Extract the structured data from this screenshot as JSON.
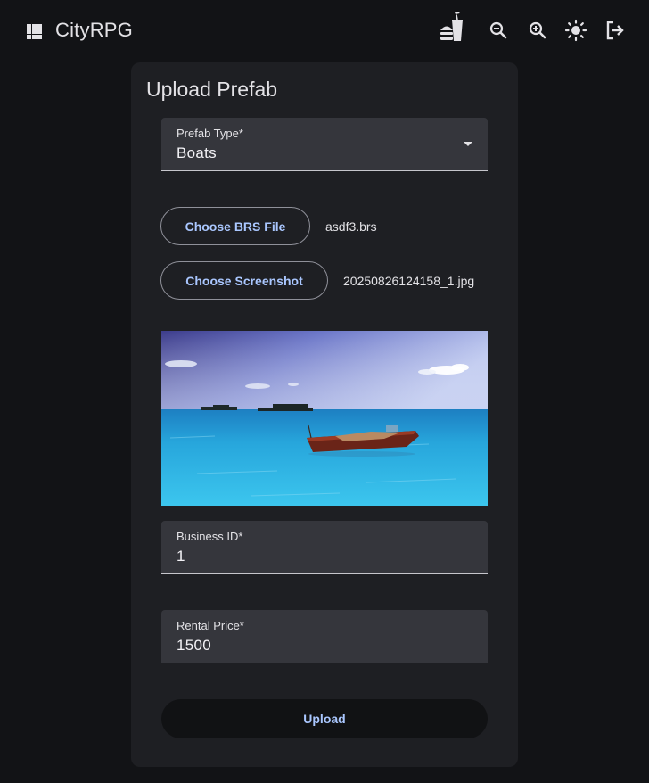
{
  "app": {
    "title": "CityRPG"
  },
  "toolbar": {
    "icons": [
      "burger-soda-icon",
      "zoom-out-icon",
      "zoom-in-icon",
      "light-mode-icon",
      "logout-icon"
    ]
  },
  "form": {
    "title": "Upload Prefab",
    "prefab_type": {
      "label": "Prefab Type*",
      "value": "Boats"
    },
    "brs_file": {
      "button_label": "Choose BRS File",
      "file_name": "asdf3.brs"
    },
    "screenshot": {
      "button_label": "Choose Screenshot",
      "file_name": "20250826124158_1.jpg"
    },
    "business_id": {
      "label": "Business ID*",
      "value": "1"
    },
    "rental_price": {
      "label": "Rental Price*",
      "value": "1500"
    },
    "upload_label": "Upload"
  },
  "colors": {
    "background": "#121316",
    "card": "#1e1f23",
    "field": "#35363c",
    "accent": "#aac7ff"
  }
}
